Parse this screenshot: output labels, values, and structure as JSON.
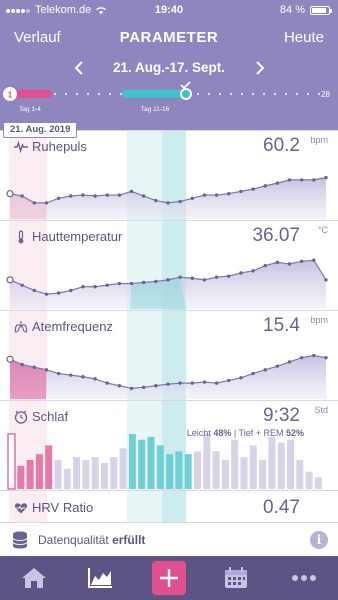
{
  "status": {
    "carrier": "Telekom.de",
    "time": "19:40",
    "battery": "84 %"
  },
  "nav": {
    "back_label": "Verlauf",
    "title": "PARAMETER",
    "today_label": "Heute"
  },
  "date_range": "21. Aug.-17. Sept.",
  "timeline": {
    "start_day": "1",
    "end_day": "28",
    "label_a": "Tag 1-4",
    "label_b": "Tag 11-16",
    "selected_day_tag": "21. Aug. 2019"
  },
  "colors": {
    "header": "#8f86bf",
    "accent_pink": "#e0508f",
    "accent_teal": "#3fc2c9",
    "tabbar": "#5d5485"
  },
  "metrics": [
    {
      "label": "Ruhepuls",
      "value": "60.2",
      "unit": "bpm",
      "icon": "heartbeat-icon"
    },
    {
      "label": "Hauttemperatur",
      "value": "36.07",
      "unit": "°C",
      "icon": "thermometer-icon"
    },
    {
      "label": "Atemfrequenz",
      "value": "15.4",
      "unit": "bpm",
      "icon": "lungs-icon"
    },
    {
      "label": "Schlaf",
      "value": "9:32",
      "unit": "Std",
      "icon": "sleep-icon"
    },
    {
      "label": "HRV Ratio",
      "value": "0.47",
      "unit": "",
      "icon": "hrv-heart-icon"
    }
  ],
  "sleep_sub": {
    "leicht_label": "Leicht",
    "leicht_pct": "48%",
    "sep": "|",
    "tief_label": "Tief + REM",
    "tief_pct": "52%"
  },
  "quality": {
    "label": "Datenqualität",
    "status": "erfüllt"
  },
  "tabs": [
    "home-icon",
    "chart-icon",
    "add-icon",
    "calendar-icon",
    "more-icon"
  ],
  "series": {
    "ruhepuls": [
      0.55,
      0.5,
      0.35,
      0.35,
      0.45,
      0.5,
      0.52,
      0.5,
      0.52,
      0.52,
      0.6,
      0.5,
      0.4,
      0.35,
      0.38,
      0.45,
      0.52,
      0.52,
      0.55,
      0.6,
      0.65,
      0.72,
      0.78,
      0.85,
      0.85,
      0.85,
      0.9
    ],
    "hauttemp": [
      0.55,
      0.45,
      0.35,
      0.28,
      0.3,
      0.35,
      0.42,
      0.42,
      0.45,
      0.48,
      0.48,
      0.5,
      0.52,
      0.55,
      0.6,
      0.58,
      0.55,
      0.6,
      0.62,
      0.68,
      0.72,
      0.82,
      0.88,
      0.85,
      0.9,
      0.92,
      0.55
    ],
    "atem": [
      0.75,
      0.65,
      0.6,
      0.55,
      0.48,
      0.45,
      0.42,
      0.38,
      0.3,
      0.25,
      0.2,
      0.22,
      0.25,
      0.28,
      0.3,
      0.3,
      0.32,
      0.3,
      0.35,
      0.4,
      0.48,
      0.55,
      0.62,
      0.7,
      0.78,
      0.82,
      0.78
    ],
    "schlaf": [
      0.95,
      0.4,
      0.5,
      0.6,
      0.75,
      0.5,
      0.35,
      0.55,
      0.5,
      0.55,
      0.45,
      0.55,
      0.7,
      0.95,
      0.85,
      0.9,
      0.75,
      0.6,
      0.65,
      0.6,
      0.65,
      0.95,
      0.65,
      0.5,
      0.85,
      0.55,
      0.75,
      0.5,
      0.9,
      0.8,
      0.85,
      0.5,
      0.3,
      0.2
    ]
  }
}
